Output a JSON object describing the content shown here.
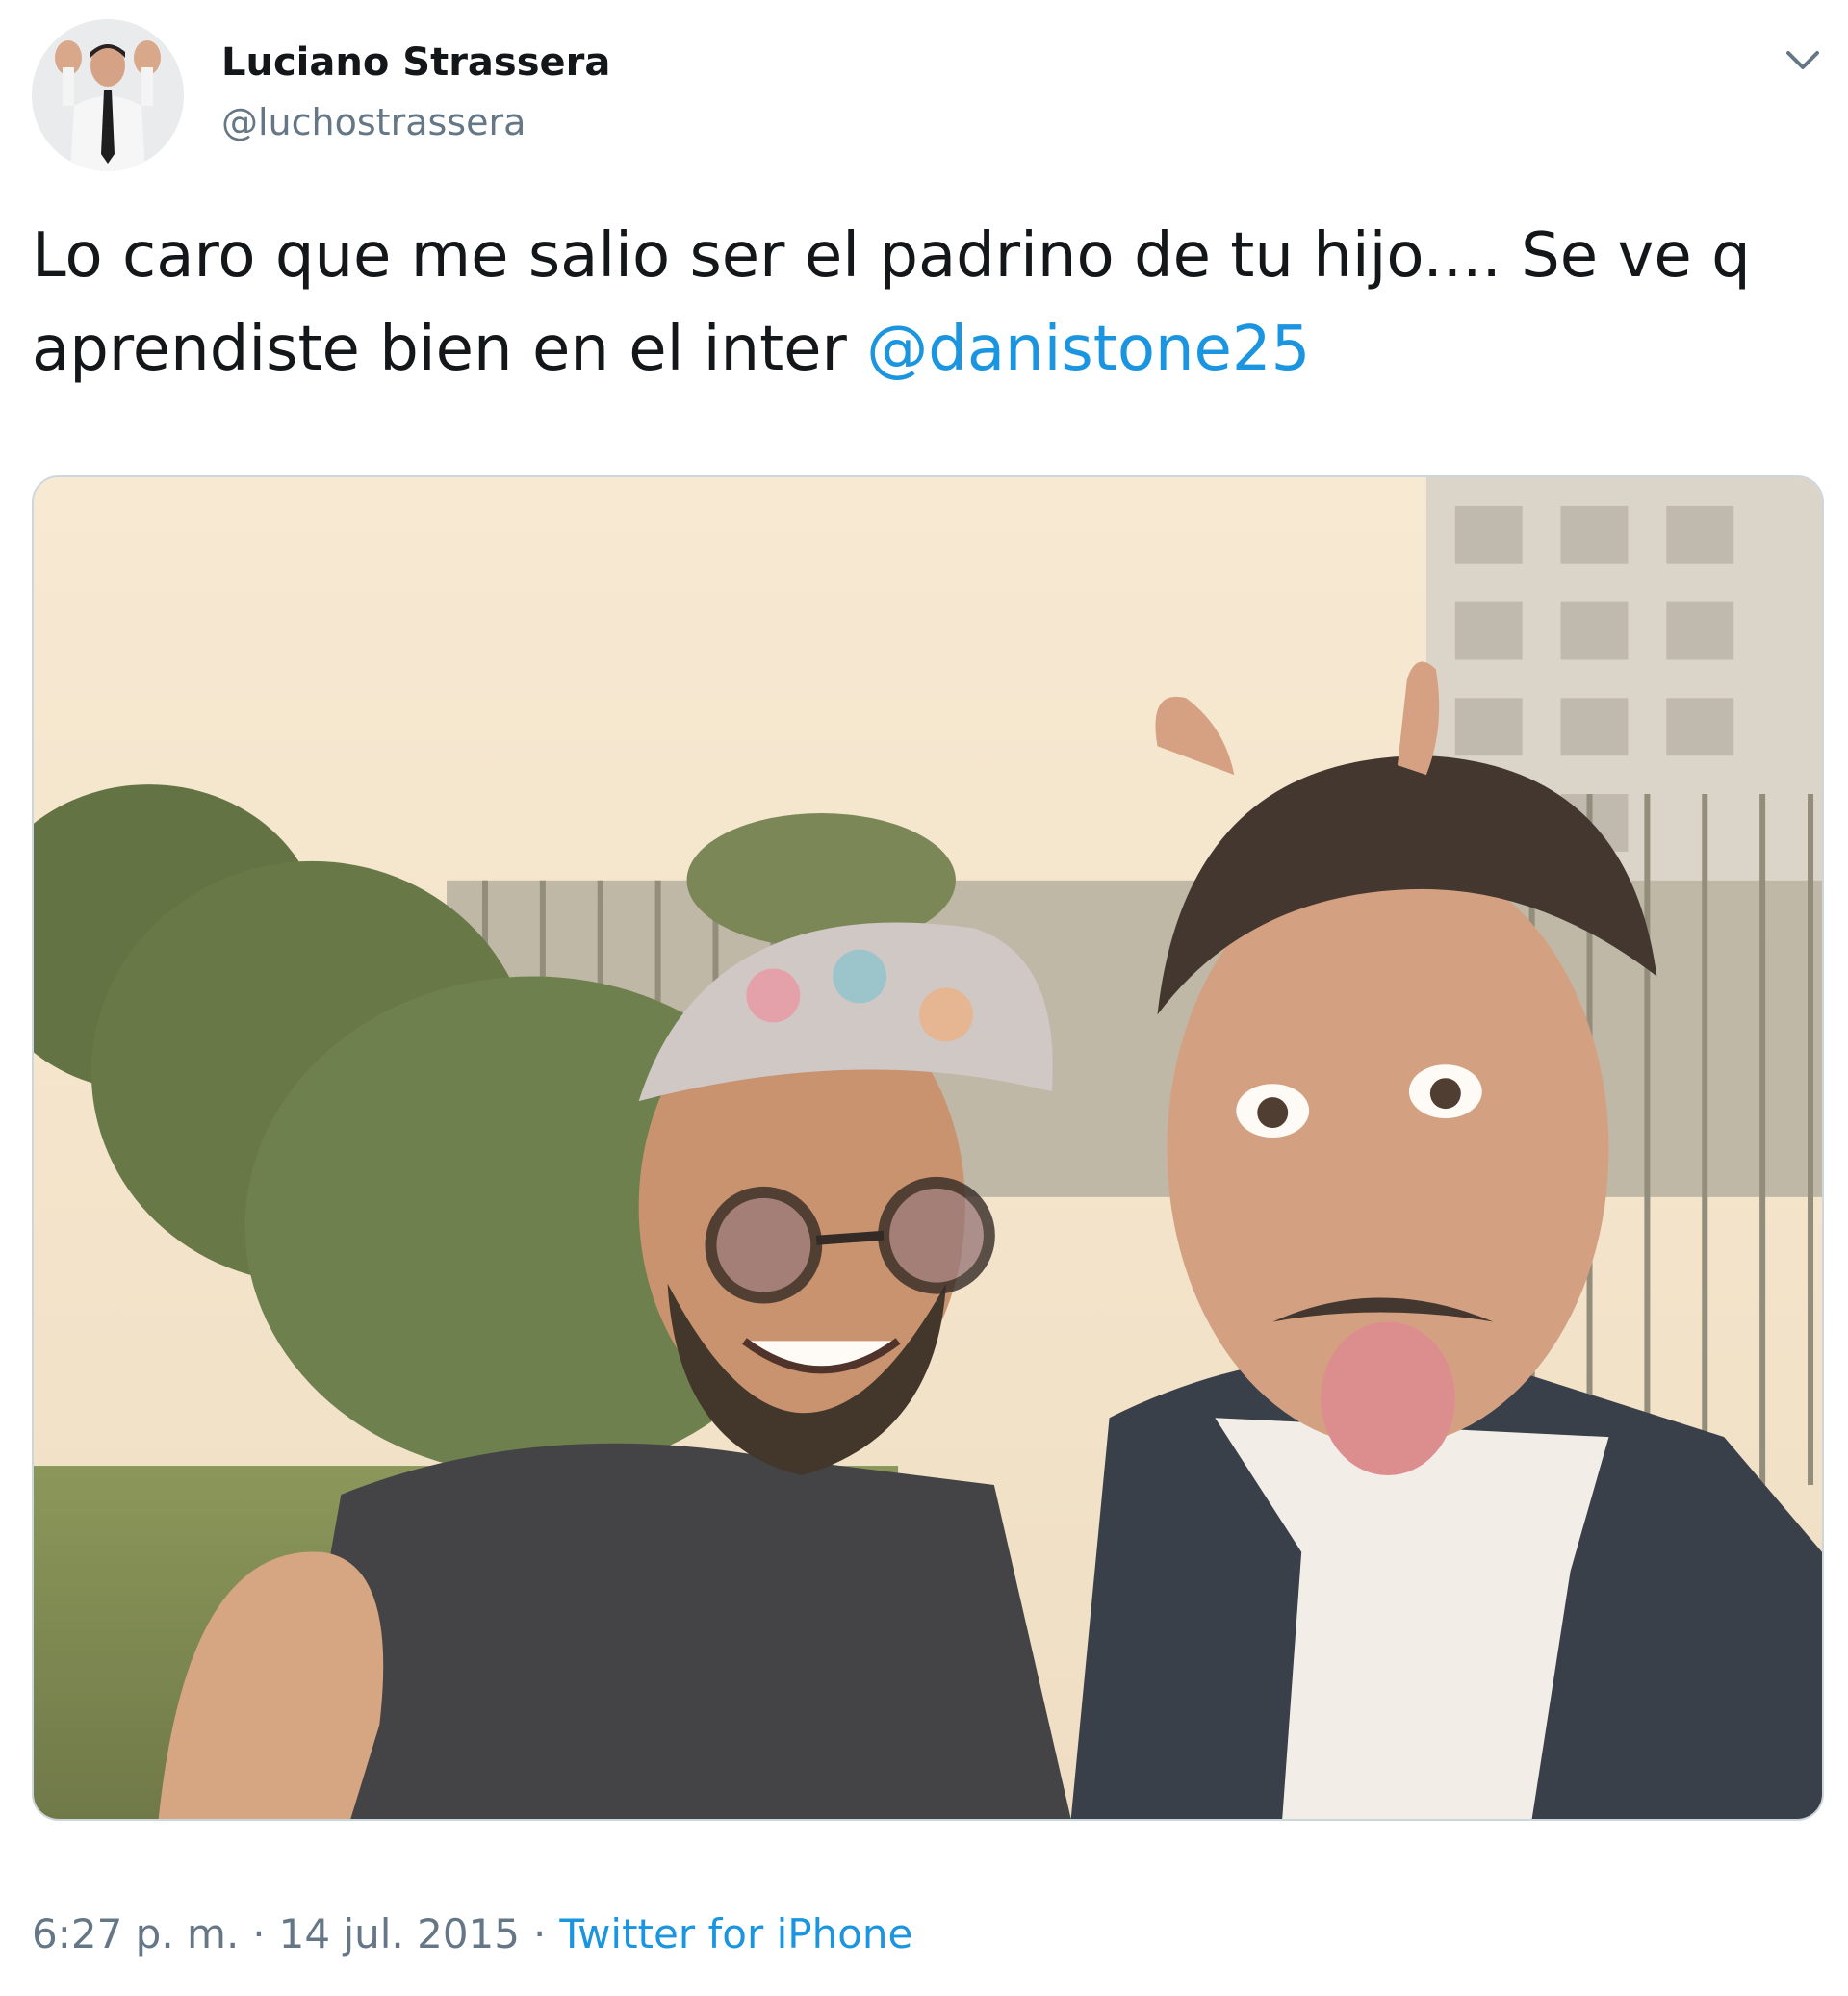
{
  "tweet": {
    "author": {
      "display_name": "Luciano Strassera",
      "handle": "@luchostrassera"
    },
    "text": {
      "line1": "Lo caro que me salio ser el padrino de tu hijo.... Se ve q",
      "line2_prefix": "aprendiste bien en el inter ",
      "mention": "@danistone25"
    },
    "meta": {
      "time": "6:27 p. m.",
      "separator1": "·",
      "date": "14 jul. 2015",
      "separator2": "·",
      "source": "Twitter for iPhone"
    }
  },
  "icons": {
    "menu": "chevron-down-icon"
  },
  "colors": {
    "text": "#14171a",
    "secondary": "#657786",
    "link": "#1b95e0",
    "border": "#ccd6dd"
  }
}
